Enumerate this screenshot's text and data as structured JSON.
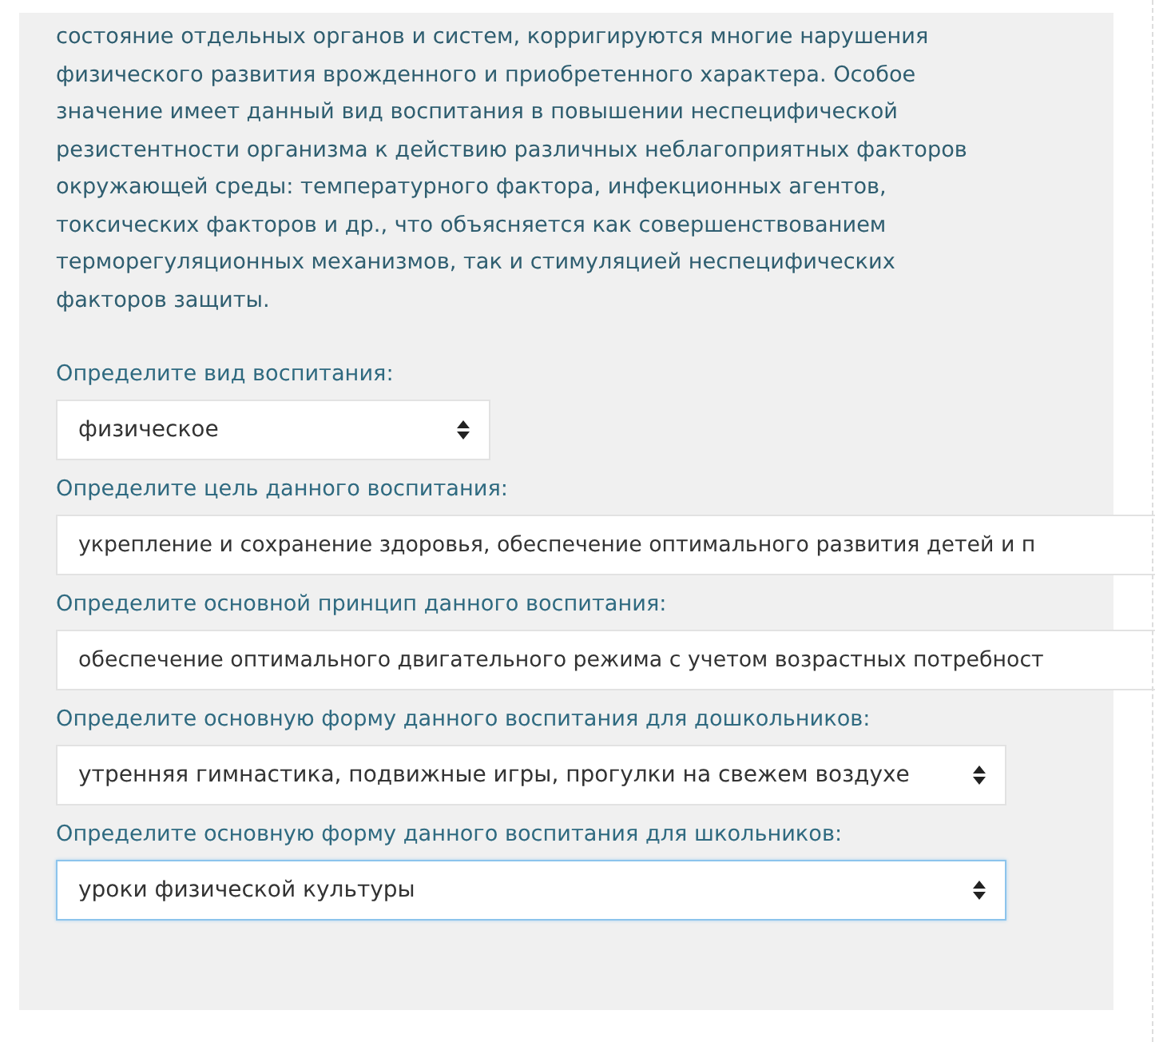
{
  "paragraph": {
    "lines": [
      "состояние отдельных органов и систем, корригируются многие нарушения",
      "физического развития врожденного и приобретенного характера. Особое",
      "значение имеет данный вид воспитания в повышении неспецифической",
      "резистентности организма к действию различных неблагоприятных факторов",
      "окружающей среды: температурного фактора, инфекционных агентов,",
      "токсических факторов и др., что объясняется как совершенствованием",
      "терморегуляционных механизмов, так и стимуляцией неспецифических",
      "факторов защиты."
    ]
  },
  "questions": [
    {
      "label": "Определите вид воспитания:",
      "kind": "select",
      "value": "физическое",
      "wide": false,
      "focused": false
    },
    {
      "label": "Определите цель данного воспитания:",
      "kind": "text",
      "value": "укрепление и сохранение здоровья, обеспечение оптимального развития детей и п",
      "focused": false
    },
    {
      "label": "Определите основной принцип данного воспитания:",
      "kind": "text",
      "value": "обеспечение оптимального двигательного режима с учетом возрастных потребност",
      "focused": false
    },
    {
      "label": "Определите основную форму данного воспитания для дошкольников:",
      "kind": "select",
      "value": "утренняя гимнастика, подвижные игры, прогулки на свежем воздухе",
      "wide": true,
      "focused": false
    },
    {
      "label": "Определите основную форму данного воспитания для школьников:",
      "kind": "select",
      "value": "уроки физической культуры",
      "wide": true,
      "focused": true
    }
  ]
}
